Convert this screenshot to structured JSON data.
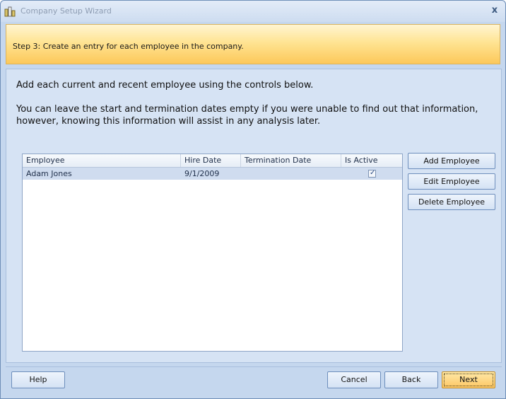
{
  "window": {
    "title": "Company Setup Wizard",
    "close_glyph": "x"
  },
  "banner": {
    "text": "Step 3: Create an entry for each employee in the company."
  },
  "intro": {
    "line1": "Add each current and recent employee using the controls below.",
    "line2": "You can leave the start and termination dates empty if you were unable to find out that information, however, knowing this information will assist in any analysis later."
  },
  "grid": {
    "columns": [
      "Employee",
      "Hire Date",
      "Termination Date",
      "Is Active"
    ],
    "rows": [
      {
        "employee": "Adam Jones",
        "hire_date": "9/1/2009",
        "termination_date": "",
        "is_active": true,
        "check_glyph": "✓"
      }
    ]
  },
  "side_buttons": {
    "add": "Add Employee",
    "edit": "Edit Employee",
    "delete": "Delete Employee"
  },
  "footer": {
    "help": "Help",
    "cancel": "Cancel",
    "back": "Back",
    "next": "Next"
  },
  "colors": {
    "banner_accent": "#fcc85a",
    "window_bg": "#c5d7ee",
    "selection": "#cfdcef"
  },
  "icons": {
    "app": "wizard-app-icon",
    "close": "close-icon",
    "check": "checkmark-icon"
  }
}
